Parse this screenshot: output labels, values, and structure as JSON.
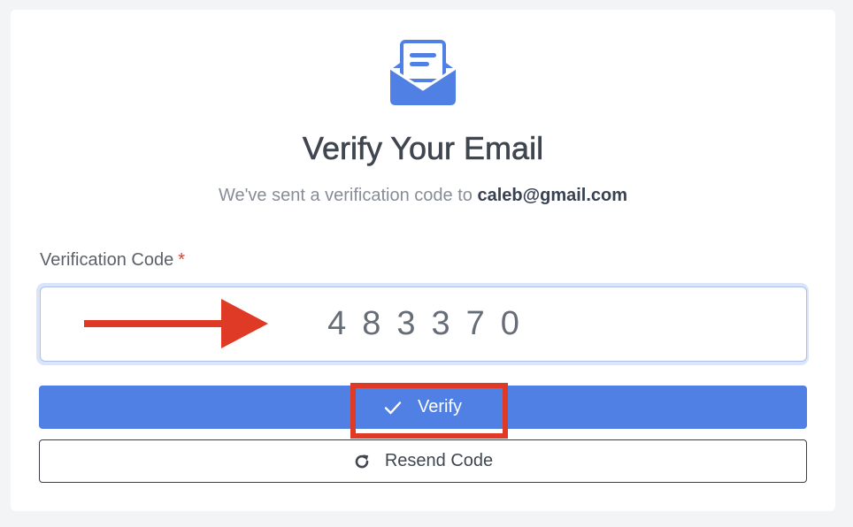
{
  "app": {
    "title": "Verify Your Email",
    "subtitle_prefix": "We've sent a verification code to ",
    "email": "caleb@gmail.com"
  },
  "form": {
    "label": "Verification Code",
    "required_mark": "*",
    "code_value": "483370"
  },
  "buttons": {
    "verify_label": "Verify",
    "resend_label": "Resend Code"
  },
  "icons": {
    "header": "mail-open-icon",
    "verify": "check-icon",
    "resend": "refresh-icon"
  },
  "annotations": {
    "arrow": "red-arrow",
    "highlight": "red-box"
  },
  "colors": {
    "primary": "#5080e3",
    "annotation": "#df3a26",
    "required": "#d9412f",
    "input_focus_ring": "#dbe5f9"
  }
}
